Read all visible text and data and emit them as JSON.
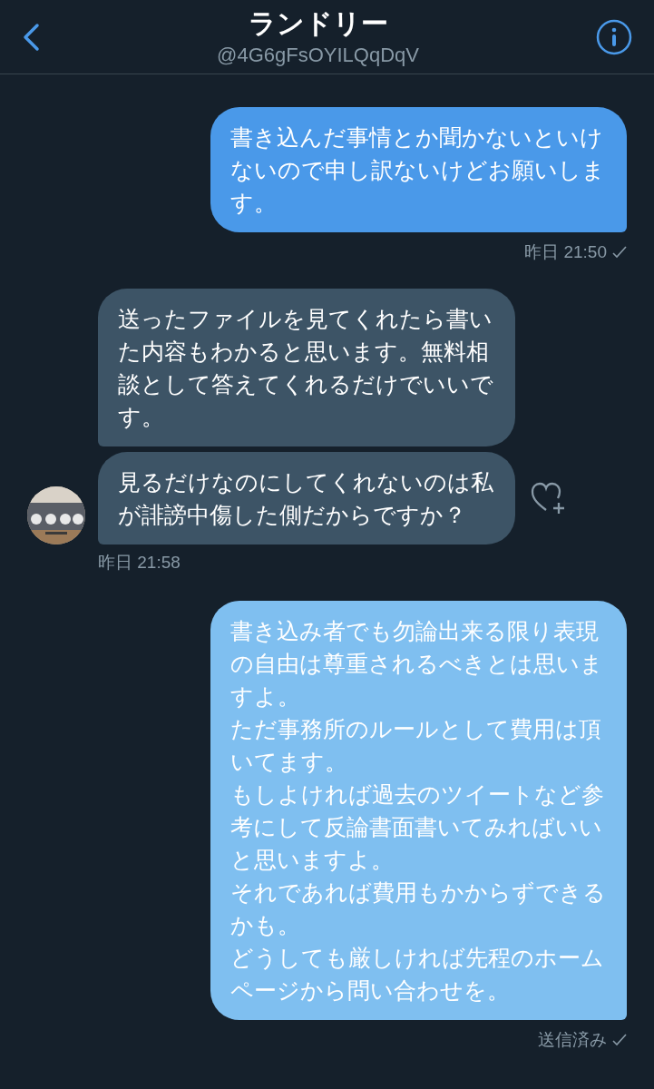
{
  "header": {
    "title": "ランドリー",
    "handle": "@4G6gFsOYILQqDqV"
  },
  "messages": [
    {
      "kind": "outgoing",
      "color": "#4a99e9",
      "paragraphs": [
        "書き込んだ事情とか聞かないといけないので申し訳ないけどお願いします。"
      ],
      "meta": "昨日 21:50"
    },
    {
      "kind": "incoming",
      "paragraphs": [
        "送ったファイルを見てくれたら書いた内容もわかると思います。無料相談として答えてくれるだけでいいです。"
      ]
    },
    {
      "kind": "incoming",
      "paragraphs": [
        "見るだけなのにしてくれないのは私が誹謗中傷した側だからですか？"
      ],
      "meta": "昨日 21:58"
    },
    {
      "kind": "outgoing",
      "color": "#7fbff0",
      "paragraphs": [
        "書き込み者でも勿論出来る限り表現の自由は尊重されるべきとは思いますよ。",
        "ただ事務所のルールとして費用は頂いてます。",
        "もしよければ過去のツイートなど参考にして反論書面書いてみればいいと思いますよ。",
        "それであれば費用もかからずできるかも。",
        "どうしても厳しければ先程のホームページから問い合わせを。"
      ],
      "meta": "送信済み"
    }
  ]
}
